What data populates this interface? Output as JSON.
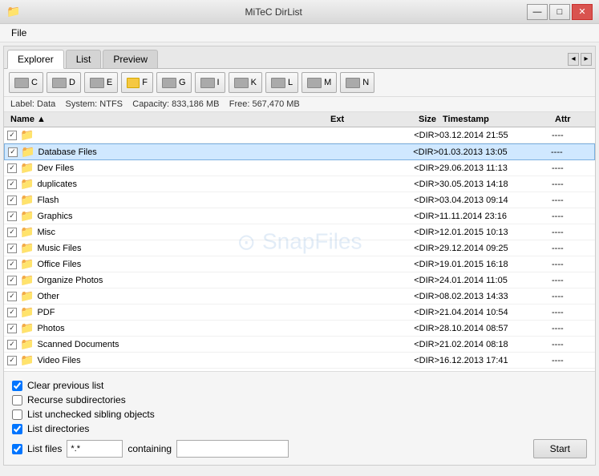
{
  "window": {
    "title": "MiTeC DirList",
    "icon": "📁"
  },
  "titlebar": {
    "minimize_label": "—",
    "maximize_label": "□",
    "close_label": "✕"
  },
  "menu": {
    "items": [
      "File"
    ]
  },
  "tabs": {
    "items": [
      "Explorer",
      "List",
      "Preview"
    ],
    "active": "Explorer"
  },
  "toolbar": {
    "buttons": [
      "C",
      "D",
      "E",
      "F",
      "G",
      "I",
      "K",
      "L",
      "M",
      "N"
    ]
  },
  "info_bar": {
    "label": "Label: Data",
    "system": "System: NTFS",
    "capacity": "Capacity: 833,186 MB",
    "free": "Free: 567,470 MB"
  },
  "file_list": {
    "columns": [
      "Name",
      "Ext",
      "Size",
      "Timestamp",
      "Attr"
    ],
    "sort_indicator": "▲",
    "rows": [
      {
        "checked": true,
        "name": "",
        "ext": "",
        "size": "<DIR>",
        "timestamp": "03.12.2014 21:55",
        "attr": "----",
        "is_parent": true
      },
      {
        "checked": true,
        "name": "Database Files",
        "ext": "",
        "size": "<DIR>",
        "timestamp": "01.03.2013 13:05",
        "attr": "----",
        "highlighted": true
      },
      {
        "checked": true,
        "name": "Dev Files",
        "ext": "",
        "size": "<DIR>",
        "timestamp": "29.06.2013 11:13",
        "attr": "----"
      },
      {
        "checked": true,
        "name": "duplicates",
        "ext": "",
        "size": "<DIR>",
        "timestamp": "30.05.2013 14:18",
        "attr": "----"
      },
      {
        "checked": true,
        "name": "Flash",
        "ext": "",
        "size": "<DIR>",
        "timestamp": "03.04.2013 09:14",
        "attr": "----"
      },
      {
        "checked": true,
        "name": "Graphics",
        "ext": "",
        "size": "<DIR>",
        "timestamp": "11.11.2014 23:16",
        "attr": "----"
      },
      {
        "checked": true,
        "name": "Misc",
        "ext": "",
        "size": "<DIR>",
        "timestamp": "12.01.2015 10:13",
        "attr": "----"
      },
      {
        "checked": true,
        "name": "Music Files",
        "ext": "",
        "size": "<DIR>",
        "timestamp": "29.12.2014 09:25",
        "attr": "----"
      },
      {
        "checked": true,
        "name": "Office Files",
        "ext": "",
        "size": "<DIR>",
        "timestamp": "19.01.2015 16:18",
        "attr": "----"
      },
      {
        "checked": true,
        "name": "Organize Photos",
        "ext": "",
        "size": "<DIR>",
        "timestamp": "24.01.2014 11:05",
        "attr": "----"
      },
      {
        "checked": true,
        "name": "Other",
        "ext": "",
        "size": "<DIR>",
        "timestamp": "08.02.2013 14:33",
        "attr": "----"
      },
      {
        "checked": true,
        "name": "PDF",
        "ext": "",
        "size": "<DIR>",
        "timestamp": "21.04.2014 10:54",
        "attr": "----"
      },
      {
        "checked": true,
        "name": "Photos",
        "ext": "",
        "size": "<DIR>",
        "timestamp": "28.10.2014 08:57",
        "attr": "----"
      },
      {
        "checked": true,
        "name": "Scanned Documents",
        "ext": "",
        "size": "<DIR>",
        "timestamp": "21.02.2014 08:18",
        "attr": "----"
      },
      {
        "checked": true,
        "name": "Video Files",
        "ext": "",
        "size": "<DIR>",
        "timestamp": "16.12.2013 17:41",
        "attr": "----"
      }
    ]
  },
  "watermark": {
    "symbol": "⊙",
    "text": "SnapFiles"
  },
  "bottom": {
    "clear_previous_list": {
      "label": "Clear previous list",
      "checked": true
    },
    "recurse_subdirectories": {
      "label": "Recurse subdirectories",
      "checked": false
    },
    "list_unchecked": {
      "label": "List unchecked sibling objects",
      "checked": false
    },
    "list_directories": {
      "label": "List directories",
      "checked": true
    },
    "list_files": {
      "label": "List files",
      "checked": true
    },
    "list_files_pattern": "*.*",
    "containing_label": "containing",
    "containing_value": "",
    "start_label": "Start"
  }
}
